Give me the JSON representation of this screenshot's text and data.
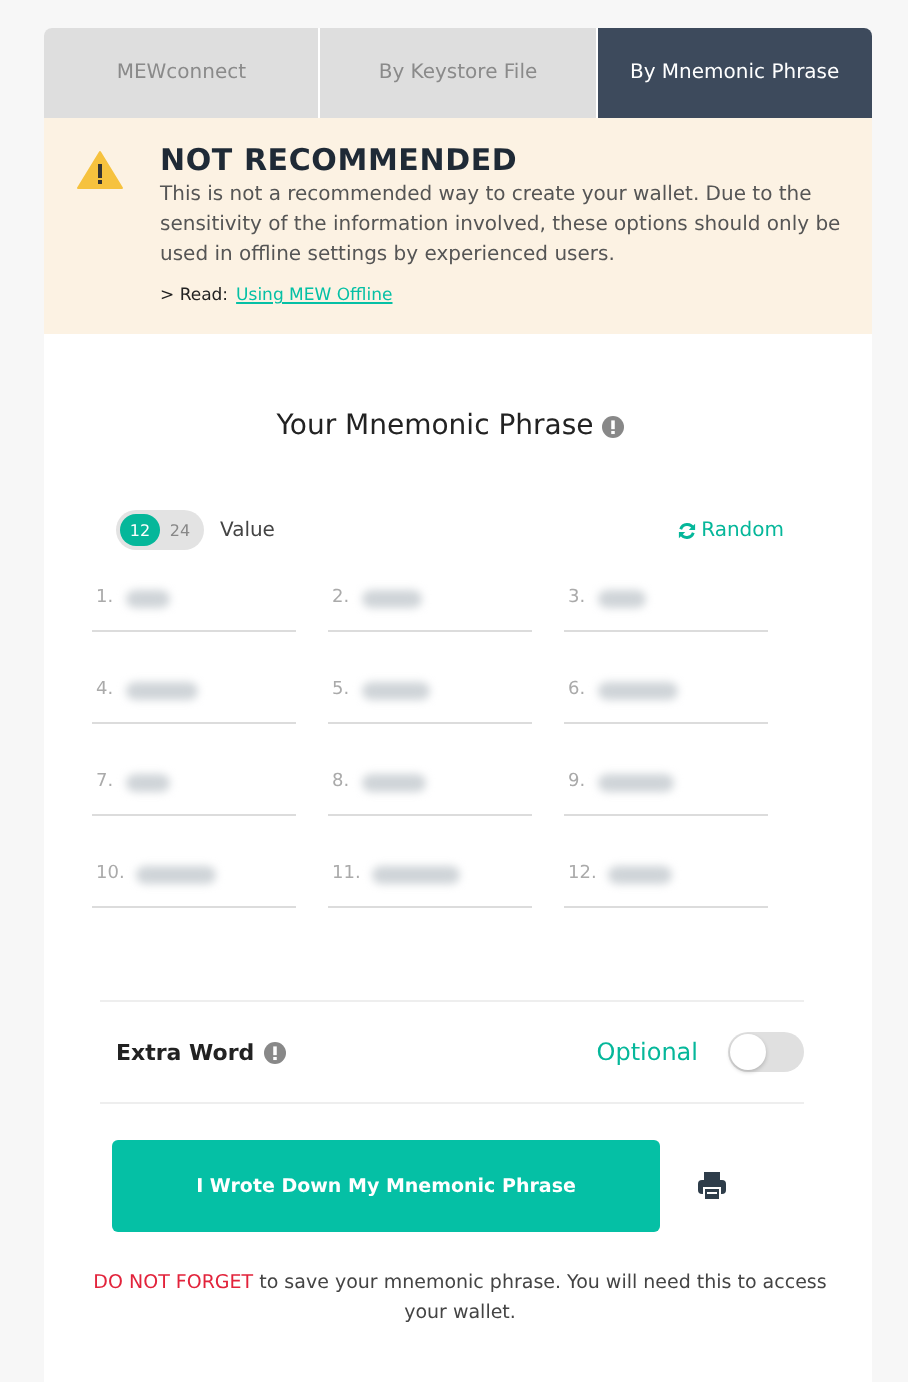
{
  "tabs": [
    {
      "label": "MEWconnect",
      "selected": false
    },
    {
      "label": "By Keystore File",
      "selected": false
    },
    {
      "label": "By Mnemonic Phrase",
      "selected": true
    }
  ],
  "warning": {
    "title": "NOT RECOMMENDED",
    "text": "This is not a recommended way to create your wallet. Due to the sensitivity of the information involved, these options should only be used in offline settings by experienced users.",
    "read_prefix": "> Read:",
    "read_link": "Using MEW Offline"
  },
  "mnemonic": {
    "title": "Your Mnemonic Phrase",
    "length_options": [
      {
        "label": "12",
        "selected": true
      },
      {
        "label": "24",
        "selected": false
      }
    ],
    "length_label": "Value",
    "random_label": "Random",
    "words": [
      {
        "number": "1."
      },
      {
        "number": "2."
      },
      {
        "number": "3."
      },
      {
        "number": "4."
      },
      {
        "number": "5."
      },
      {
        "number": "6."
      },
      {
        "number": "7."
      },
      {
        "number": "8."
      },
      {
        "number": "9."
      },
      {
        "number": "10."
      },
      {
        "number": "11."
      },
      {
        "number": "12."
      }
    ]
  },
  "extra_word": {
    "label": "Extra Word",
    "optional_label": "Optional",
    "on": false
  },
  "confirm_button": "I Wrote Down My Mnemonic Phrase",
  "footer": {
    "emphasis": "DO NOT FORGET",
    "text": " to save your mnemonic phrase. You will need this to access your wallet."
  }
}
